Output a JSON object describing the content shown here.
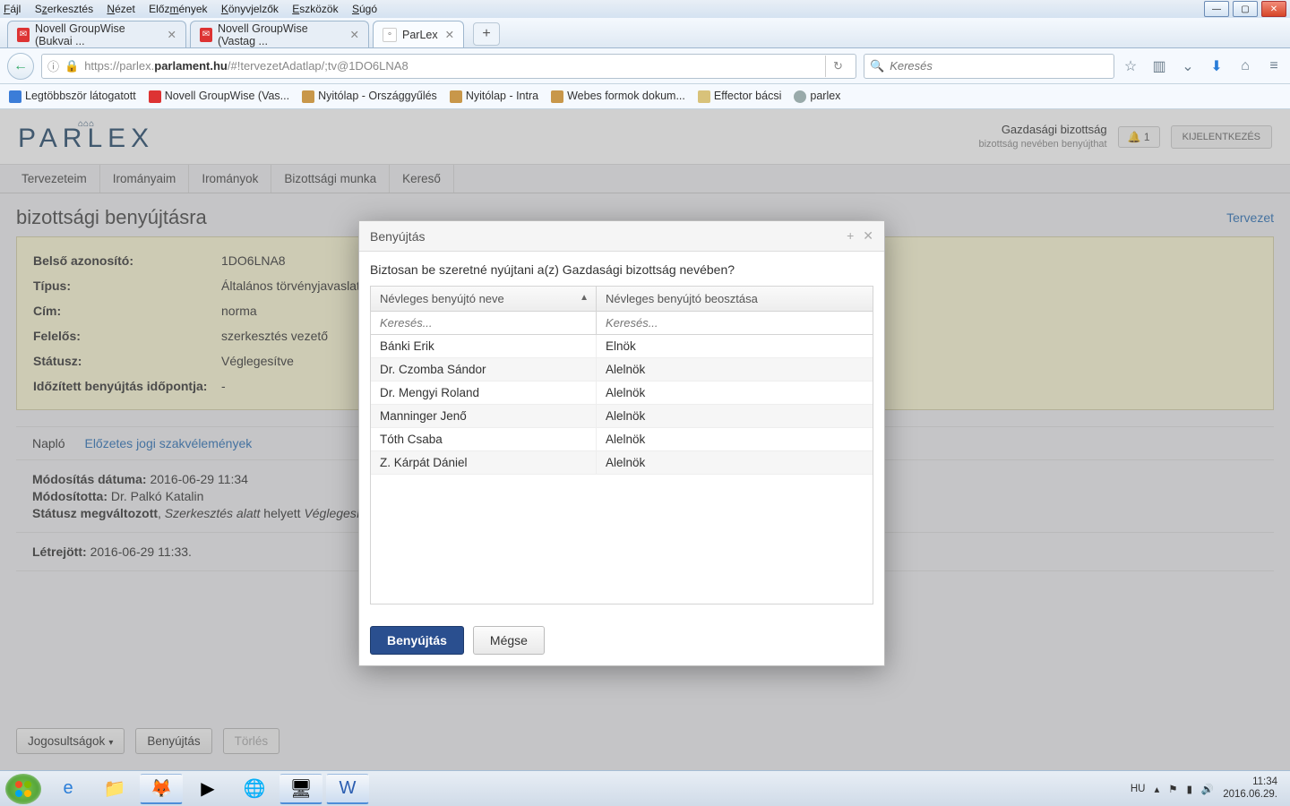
{
  "win_menu": [
    "Fájl",
    "Szerkesztés",
    "Nézet",
    "Előzmények",
    "Könyvjelzők",
    "Eszközök",
    "Súgó"
  ],
  "browser_tabs": [
    {
      "label": "Novell GroupWise (Bukvai ...",
      "icon": "red"
    },
    {
      "label": "Novell GroupWise (Vastag ...",
      "icon": "red"
    },
    {
      "label": "ParLex",
      "icon": "plain",
      "active": true
    }
  ],
  "url": "https://parlex.parlament.hu/#!tervezetAdatlap/;tv@1DO6LNA8",
  "url_domain": "parlament.hu",
  "url_prefix": "https://parlex.",
  "url_suffix": "/#!tervezetAdatlap/;tv@1DO6LNA8",
  "search_placeholder": "Keresés",
  "bookmarks": [
    {
      "label": "Legtöbbször látogatott",
      "cls": "blue"
    },
    {
      "label": "Novell GroupWise (Vas...",
      "cls": "red"
    },
    {
      "label": "Nyitólap - Országgyűlés",
      "cls": "gold"
    },
    {
      "label": "Nyitólap - Intra",
      "cls": "gold"
    },
    {
      "label": "Webes formok dokum...",
      "cls": "gold"
    },
    {
      "label": "Effector bácsi",
      "cls": "tan"
    },
    {
      "label": "parlex",
      "cls": "globe"
    }
  ],
  "logo": "PARLEX",
  "header": {
    "t1": "Gazdasági bizottság",
    "t2": "bizottság nevében benyújthat",
    "bell": "1",
    "logout": "KIJELENTKEZÉS"
  },
  "app_tabs": [
    "Tervezeteim",
    "Irományaim",
    "Irományok",
    "Bizottsági munka",
    "Kereső"
  ],
  "page_title": "bizottsági benyújtásra",
  "page_link": "Tervezet",
  "form": [
    {
      "lbl": "Belső azonosító:",
      "val": "1DO6LNA8"
    },
    {
      "lbl": "Típus:",
      "val": "Általános törvényjavaslat"
    },
    {
      "lbl": "Cím:",
      "val": "norma"
    },
    {
      "lbl": "Felelős:",
      "val": "szerkesztés vezető"
    },
    {
      "lbl": "Státusz:",
      "val": "Véglegesítve"
    },
    {
      "lbl": "Időzített benyújtás időpontja:",
      "val": "-"
    }
  ],
  "sub_tabs": {
    "active": "Napló",
    "other": "Előzetes jogi szakvélemények"
  },
  "log": {
    "l1_lbl": "Módosítás dátuma:",
    "l1_val": "2016-06-29 11:34",
    "l2_lbl": "Módosította:",
    "l2_val": "Dr. Palkó Katalin",
    "l3_lbl": "Státusz megváltozott",
    "l3_a": "Szerkesztés alatt",
    "l3_mid": " helyett ",
    "l3_b": "Véglegesítve",
    "l4_lbl": "Létrejött:",
    "l4_val": "2016-06-29 11:33."
  },
  "bottom": {
    "b1": "Jogosultságok",
    "b2": "Benyújtás",
    "b3": "Törlés"
  },
  "modal": {
    "title": "Benyújtás",
    "question": "Biztosan be szeretné nyújtani a(z) Gazdasági bizottság nevében?",
    "col1": "Névleges benyújtó neve",
    "col2": "Névleges benyújtó beosztása",
    "filter_ph": "Keresés...",
    "rows": [
      {
        "name": "Bánki Erik",
        "pos": "Elnök"
      },
      {
        "name": "Dr. Czomba Sándor",
        "pos": "Alelnök"
      },
      {
        "name": "Dr. Mengyi Roland",
        "pos": "Alelnök"
      },
      {
        "name": "Manninger Jenő",
        "pos": "Alelnök"
      },
      {
        "name": "Tóth Csaba",
        "pos": "Alelnök"
      },
      {
        "name": "Z. Kárpát Dániel",
        "pos": "Alelnök"
      }
    ],
    "ok": "Benyújtás",
    "cancel": "Mégse"
  },
  "tray": {
    "lang": "HU",
    "time": "11:34",
    "date": "2016.06.29."
  }
}
